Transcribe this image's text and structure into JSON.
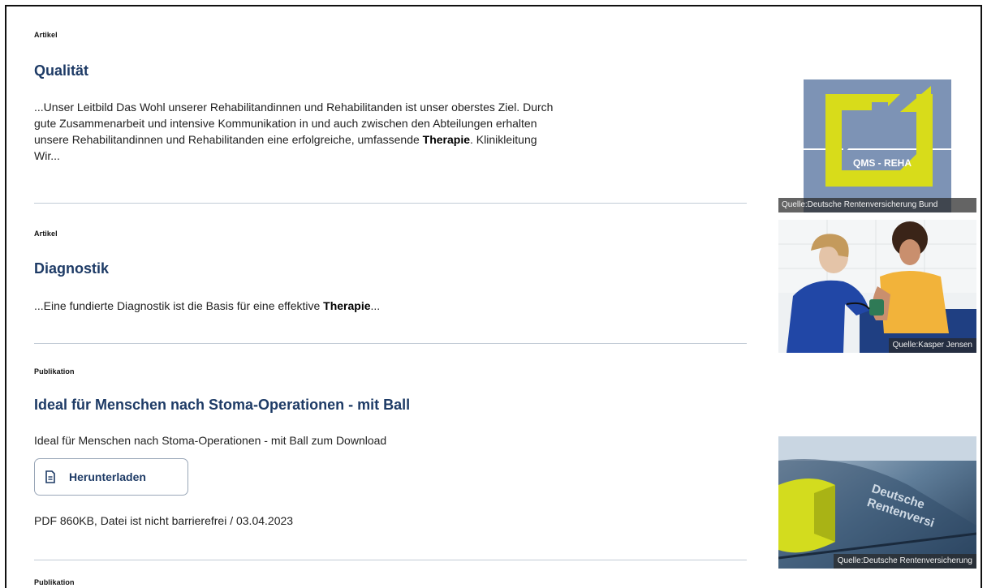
{
  "results": [
    {
      "type": "Artikel",
      "title": "Qualität",
      "snippet_pre": "...Unser Leitbild Das Wohl unserer Rehabilitandinnen und Rehabilitanden ist unser oberstes Ziel. Durch gute Zusammenarbeit und intensive Kommunikation in und auch zwischen den Abteilungen erhalten unsere Rehabilitandinnen und Rehabilitanden eine erfolgreiche, umfassende ",
      "snippet_bold": "Therapie",
      "snippet_post": ". Klinikleitung Wir...",
      "image": {
        "caption": "Quelle:Deutsche Rentenversicherung Bund",
        "logo_text": "QMS - REHA",
        "icon": "qms-reha-logo"
      }
    },
    {
      "type": "Artikel",
      "title": "Diagnostik",
      "snippet_pre": "...Eine fundierte Diagnostik ist die Basis für eine effektive ",
      "snippet_bold": "Therapie",
      "snippet_post": "...",
      "image": {
        "caption": "Quelle:Kasper Jensen",
        "icon": "blood-pressure-photo"
      }
    },
    {
      "type": "Publikation",
      "title": "Ideal für Menschen nach Stoma-Operationen - mit Ball",
      "snippet_pre": "Ideal für Menschen nach Stoma-Operationen - mit Ball zum Download",
      "download_label": "Herunterladen",
      "download_icon": "document-icon",
      "file_meta": "PDF 860KB, Datei ist nicht barrierefrei / 03.04.2023",
      "image": {
        "caption": "Quelle:Deutsche Rentenversicherung",
        "sign_text": "Deutsche Rentenversi",
        "icon": "building-sign-photo"
      }
    },
    {
      "type": "Publikation"
    }
  ],
  "colors": {
    "title": "#1e3b66",
    "divider": "#c2cbd6",
    "logo_yellow": "#d8dc1a",
    "logo_bg": "#7d93b5"
  }
}
